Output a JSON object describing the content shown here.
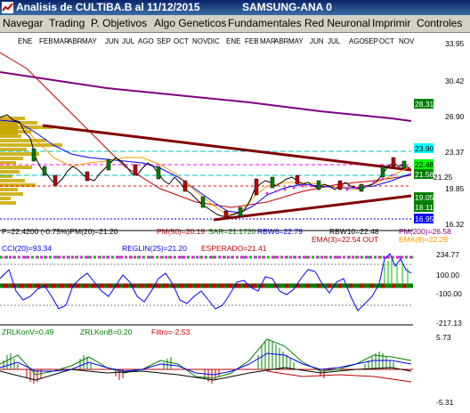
{
  "window": {
    "title": "Analisis de CULTIBA.B al 11/12/2015",
    "symbol": "SAMSUNG-ANA 0"
  },
  "menu": [
    "Navegar",
    "Trading",
    "P. Objetivos",
    "Algo Geneticos",
    "Fundamentales",
    "Red Neuronal",
    "Imprimir",
    "Controles"
  ],
  "months": [
    "ENE",
    "FEB",
    "MAR",
    "ABR",
    "MAY",
    "JUN",
    "JUL",
    "AGO",
    "SEP",
    "OCT",
    "NOV",
    "DIC",
    "ENE",
    "FEB",
    "MAR",
    "ABR",
    "MAY",
    "JUN",
    "JUL",
    "AGO",
    "SEP",
    "OCT",
    "NOV"
  ],
  "price_axis": [
    "33.95",
    "30.42",
    "26.90",
    "23.37",
    "19.85",
    "16.32"
  ],
  "price_tags": [
    "28.31",
    "23.90",
    "22.48",
    "21.58",
    "21.25",
    "19.05",
    "18.11",
    "16.95"
  ],
  "price_labels": {
    "status": "P=22.4200 (-0.75%)PM(20)=21.20",
    "pm50": "PM(50)=20.19",
    "sar": "SAR=21.1720",
    "rbw6": "RBW6=22.79",
    "rbw10": "RBW10=22.48",
    "pm200": "PM(200)=26.58",
    "ema3": "EMA(3)=22.54 OUT",
    "ema8": "EMA(8)=22.29"
  },
  "cci_panel": {
    "cci": "CCI(20)=93.34",
    "reglin": "REGLIN(25)=21.20",
    "esperado": "ESPERADO=21.41",
    "axis": [
      "234.77",
      "100.00",
      "-100.00",
      "-217.13"
    ]
  },
  "zrl_panel": {
    "konv": "ZRLKonV=0.49",
    "konb": "ZRLKonB=0.20",
    "filtro": "Filtro=-2.53",
    "axis": [
      "5.73",
      "-5.31"
    ]
  },
  "colors": {
    "titlebar": "#0a246a",
    "menubar": "#d4d0c8",
    "trendline": "#800000",
    "pm200": "#800080",
    "pm20": "#0000ff",
    "cci_line": "#0000ff",
    "zrl_line": "#008000",
    "panel_bar_green": "#008000",
    "panel_bar_red": "#ff0000",
    "tag_green": "#008000",
    "tag_cyan": "#00ffff",
    "tag_blue": "#0000ff"
  }
}
